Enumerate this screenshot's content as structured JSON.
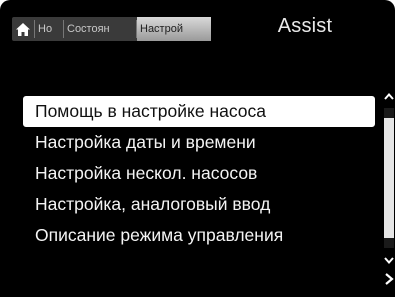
{
  "header": {
    "tabs": [
      {
        "icon": "home-icon"
      },
      {
        "label": "Но"
      },
      {
        "label": "Состоян"
      },
      {
        "label": "Настрой"
      }
    ],
    "title": "Assist"
  },
  "menu": {
    "items": [
      {
        "label": "Помощь в настройке насоса",
        "selected": true
      },
      {
        "label": "Настройка даты и времени"
      },
      {
        "label": "Настройка нескол. насосов"
      },
      {
        "label": "Настройка, аналоговый ввод"
      },
      {
        "label": "Описание режима управления"
      }
    ]
  },
  "scrollbar": {
    "icons": [
      "chevron-up-icon",
      "chevron-down-icon",
      "chevron-right-icon"
    ]
  },
  "colors": {
    "background": "#000000",
    "text": "#f4f4f4",
    "selected_bg": "#ffffff",
    "active_tab": "#bdbdbd"
  }
}
